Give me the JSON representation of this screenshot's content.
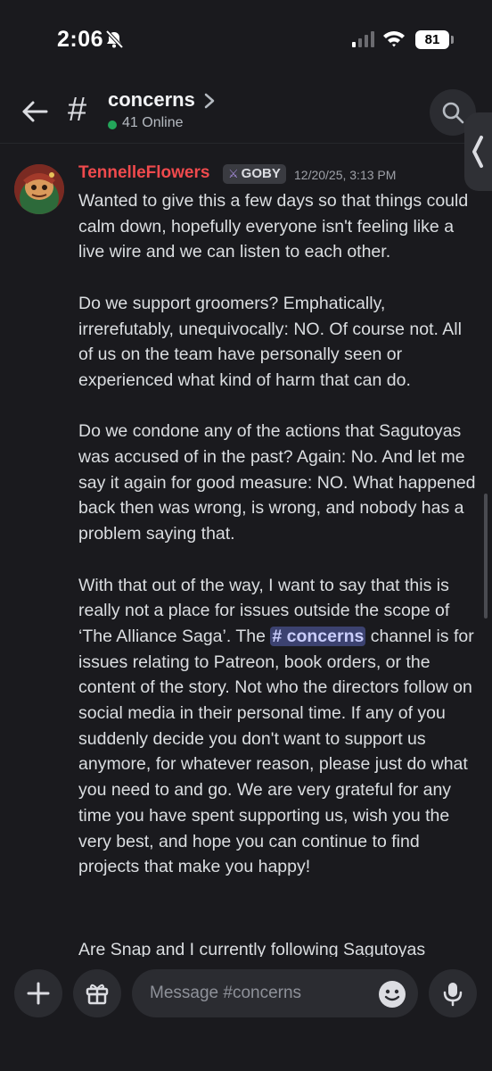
{
  "status_bar": {
    "time": "2:06",
    "battery": "81"
  },
  "header": {
    "hash_symbol": "#",
    "channel_name": "concerns",
    "online_count": "41 Online"
  },
  "message": {
    "author": "TennelleFlowers",
    "role_tag": "GOBY",
    "timestamp": "12/20/25, 3:13 PM",
    "paragraphs": [
      "Wanted to give this a few days so that things could calm down, hopefully everyone isn't feeling like a live wire and we can listen to each other.",
      "Do we support groomers? Emphatically, irrerefutably, unequivocally: NO. Of course not. All of us on the team have personally seen or experienced what kind of harm that can do.",
      "Do we condone any of the actions that Sagutoyas was accused of in the past? Again: No. And let me say it again for good measure: NO. What happened back then was wrong, is wrong, and nobody has a problem saying that."
    ],
    "para4_before_mention": "With that out of the way, I want to say that this is really not a place for issues outside the scope of ‘The Alliance Saga’. The ",
    "para4_mention": "# concerns",
    "para4_after_mention": " channel is for issues relating to Patreon, book orders, or the content of the story. Not who the directors follow on social media in their personal time. If any of you suddenly decide you don't want to support us anymore, for whatever reason, please just do what you need to and go. We are very grateful for any time you have spent supporting us, wish you the very best, and hope you can continue to find projects that make you happy!",
    "next_message_partial": "Are Snap and I currently following Sagutoyas"
  },
  "composer": {
    "placeholder": "Message #concerns"
  },
  "colors": {
    "background": "#1a1a1e",
    "author": "#f04a4d",
    "online": "#23a55a",
    "mention_bg": "#3c4270"
  },
  "icons": [
    "bell-slash-icon",
    "signal-icon",
    "wifi-icon",
    "battery-icon",
    "back-arrow-icon",
    "hash-icon",
    "chevron-right-icon",
    "search-icon",
    "chevron-left-icon",
    "plus-icon",
    "gift-icon",
    "emoji-icon",
    "microphone-icon",
    "role-tag-icon"
  ]
}
